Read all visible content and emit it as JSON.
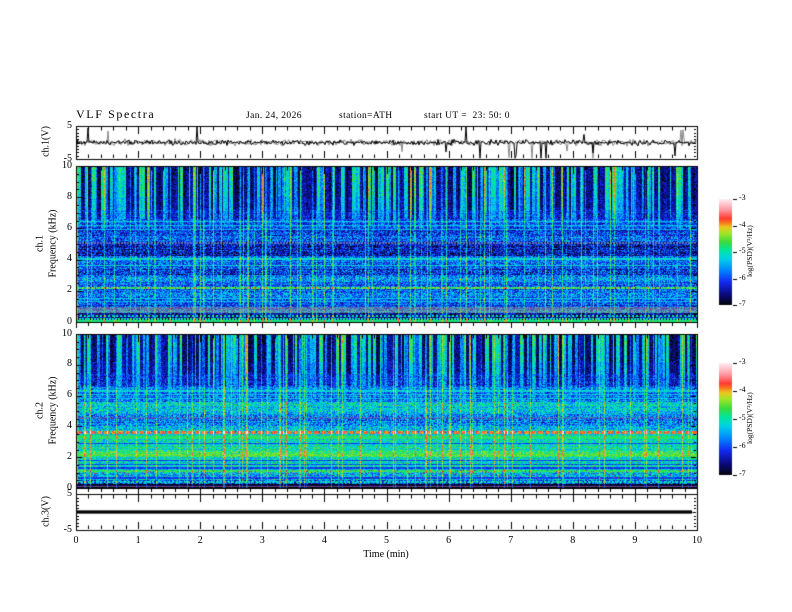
{
  "header": {
    "title": "VLF Spectra",
    "date": "Jan. 24, 2026",
    "station": "station=ATH",
    "start_ut": "start UT =  23: 50: 0"
  },
  "xaxis": {
    "label": "Time (min)",
    "ticks": [
      "0",
      "1",
      "2",
      "3",
      "4",
      "5",
      "6",
      "7",
      "8",
      "9",
      "10"
    ],
    "minor_per_major": 5,
    "range_min": [
      0,
      10
    ]
  },
  "panels": {
    "ch1_wave": {
      "label": "ch.1(V)",
      "yticks": [
        {
          "value": 5,
          "label": "5"
        },
        {
          "value": -5,
          "label": "-5"
        }
      ],
      "y_range": [
        -5,
        5
      ]
    },
    "spec1": {
      "channel": "ch.1",
      "axis": "Frequency (kHz)",
      "yticks": [
        0,
        2,
        4,
        6,
        8,
        10
      ],
      "y_range_khz": [
        0,
        10
      ]
    },
    "spec2": {
      "channel": "ch.2",
      "axis": "Frequency (kHz)",
      "yticks": [
        0,
        2,
        4,
        6,
        8,
        10
      ],
      "y_range_khz": [
        0,
        10
      ]
    },
    "ch3_wave": {
      "label": "ch.3(V)",
      "yticks": [
        {
          "value": 5,
          "label": "5"
        },
        {
          "value": -5,
          "label": "-5"
        }
      ],
      "y_range": [
        -5,
        5
      ]
    }
  },
  "colorbar": {
    "label": "log(PSD)(V²/Hz)",
    "ticks": [
      "-3",
      "-4",
      "-5",
      "-6",
      "-7"
    ],
    "value_range": [
      -7,
      -3
    ]
  },
  "chart_data": [
    {
      "type": "line",
      "name": "ch1-waveform",
      "ylabel": "ch.1(V)",
      "x_range_min": [
        0,
        10
      ],
      "y_range_v": [
        -5,
        5
      ],
      "description": "broadband noise around 0 V, ~±1 V, impulsive spikes mostly downward to -4 V",
      "noise_sigma": 0.5,
      "spike_rate": 0.012,
      "spike_amp": [
        1.5,
        4.5
      ],
      "spike_negative_fraction": 0.75,
      "trace_color": "#000000",
      "shadow_color": "#8a8a8a"
    },
    {
      "type": "heatmap",
      "name": "ch1-spectrogram",
      "x_range_min": [
        0,
        10
      ],
      "y_range_khz": [
        0,
        10
      ],
      "value_range_log_psd": [
        -7,
        -3
      ],
      "left_edge_value": 0.62,
      "vlines_count_prob": 0.12,
      "vline_boost": [
        0.12,
        0.28
      ],
      "bands": [
        {
          "lo": 9.0,
          "hi": 10.0,
          "v": 0.1,
          "n": 0.22,
          "streak": 1.0
        },
        {
          "lo": 8.0,
          "hi": 9.0,
          "v": 0.13,
          "n": 0.22,
          "streak": 0.92
        },
        {
          "lo": 7.2,
          "hi": 8.0,
          "v": 0.18,
          "n": 0.2,
          "streak": 0.75
        },
        {
          "lo": 6.6,
          "hi": 7.2,
          "v": 0.24,
          "n": 0.2,
          "streak": 0.5
        },
        {
          "lo": 6.0,
          "hi": 6.6,
          "v": 0.28,
          "n": 0.18,
          "streak": 0.25
        },
        {
          "lo": 5.15,
          "hi": 6.0,
          "v": 0.26,
          "n": 0.16
        },
        {
          "lo": 4.2,
          "hi": 5.15,
          "v": 0.17,
          "n": 0.17
        },
        {
          "lo": 3.4,
          "hi": 4.2,
          "v": 0.3,
          "n": 0.16
        },
        {
          "lo": 3.0,
          "hi": 3.4,
          "v": 0.22,
          "n": 0.18
        },
        {
          "lo": 2.55,
          "hi": 3.0,
          "v": 0.33,
          "n": 0.16
        },
        {
          "lo": 2.3,
          "hi": 2.55,
          "v": 0.27,
          "n": 0.14
        },
        {
          "lo": 1.2,
          "hi": 2.3,
          "v": 0.3,
          "n": 0.16
        },
        {
          "lo": 0.95,
          "hi": 1.2,
          "v": 0.27,
          "n": 0.15
        },
        {
          "lo": 0.75,
          "hi": 0.95,
          "v": 0.3,
          "n": 0.2,
          "tint": "#aa7788",
          "tm": 0.45,
          "spk": "#993399",
          "sp": 0.06
        },
        {
          "lo": 0.55,
          "hi": 0.75,
          "v": 0.33,
          "n": 0.2,
          "tint": "#a0a080",
          "tm": 0.45
        },
        {
          "lo": 0.28,
          "hi": 0.55,
          "v": 0.12,
          "n": 0.16
        },
        {
          "lo": 0.14,
          "hi": 0.28,
          "v": 0.1,
          "n": 0.2
        },
        {
          "lo": 0.0,
          "hi": 0.14,
          "v": 0.02,
          "n": 0.03
        }
      ],
      "lines": [
        {
          "f": 9.97,
          "w": 0.08,
          "v": 0.45
        },
        {
          "f": 6.45,
          "w": 0.06,
          "v": 0.42
        },
        {
          "f": 6.18,
          "w": 0.05,
          "v": 0.4
        },
        {
          "f": 5.95,
          "w": 0.05,
          "v": 0.38
        },
        {
          "f": 5.08,
          "w": 0.1,
          "v": 0.32,
          "dot": [
            3,
            1.6
          ],
          "tint": "#996688",
          "tm": 0.55
        },
        {
          "f": 4.03,
          "w": 0.07,
          "v": 0.45
        },
        {
          "f": 3.62,
          "w": 0.07,
          "v": 0.44
        },
        {
          "f": 2.2,
          "w": 0.11,
          "v": 0.62,
          "dot": [
            5,
            3.5
          ]
        },
        {
          "f": 1.52,
          "w": 0.05,
          "v": 0.42
        },
        {
          "f": 1.33,
          "w": 0.05,
          "v": 0.4
        },
        {
          "f": 0.4,
          "w": 0.07,
          "v": 0.5,
          "dot": [
            4,
            2
          ]
        },
        {
          "f": 0.2,
          "w": 0.06,
          "v": 0.5,
          "dot": [
            3,
            1.5
          ]
        },
        {
          "f": 0.06,
          "w": 0.05,
          "v": 0.55,
          "dot": [
            2,
            1.4
          ]
        }
      ]
    },
    {
      "type": "heatmap",
      "name": "ch2-spectrogram",
      "x_range_min": [
        0,
        10
      ],
      "y_range_khz": [
        0,
        10
      ],
      "value_range_log_psd": [
        -7,
        -3
      ],
      "left_edge_value": 0.62,
      "vlines_count_prob": 0.12,
      "vline_boost": [
        0.12,
        0.28
      ],
      "bands": [
        {
          "lo": 9.2,
          "hi": 10.0,
          "v": 0.12,
          "n": 0.22,
          "streak": 1.0
        },
        {
          "lo": 8.2,
          "hi": 9.2,
          "v": 0.14,
          "n": 0.22,
          "streak": 0.9
        },
        {
          "lo": 7.4,
          "hi": 8.2,
          "v": 0.2,
          "n": 0.2,
          "streak": 0.7
        },
        {
          "lo": 6.6,
          "hi": 7.4,
          "v": 0.26,
          "n": 0.2,
          "streak": 0.45
        },
        {
          "lo": 5.6,
          "hi": 6.6,
          "v": 0.33,
          "n": 0.18,
          "streak": 0.2
        },
        {
          "lo": 4.8,
          "hi": 5.6,
          "v": 0.44,
          "n": 0.15
        },
        {
          "lo": 4.0,
          "hi": 4.8,
          "v": 0.32,
          "n": 0.17
        },
        {
          "lo": 3.55,
          "hi": 4.0,
          "v": 0.44,
          "n": 0.15
        },
        {
          "lo": 2.4,
          "hi": 3.55,
          "v": 0.48,
          "n": 0.14
        },
        {
          "lo": 2.0,
          "hi": 2.4,
          "v": 0.55,
          "n": 0.12
        },
        {
          "lo": 1.15,
          "hi": 2.0,
          "v": 0.46,
          "n": 0.14
        },
        {
          "lo": 0.5,
          "hi": 1.15,
          "v": 0.42,
          "n": 0.17,
          "spk": "#883399",
          "sp": 0.05
        },
        {
          "lo": 0.25,
          "hi": 0.5,
          "v": 0.3,
          "n": 0.2
        },
        {
          "lo": 0.0,
          "hi": 0.25,
          "v": 0.03,
          "n": 0.04
        }
      ],
      "lines": [
        {
          "f": 9.97,
          "w": 0.08,
          "v": 0.48
        },
        {
          "f": 6.3,
          "w": 0.06,
          "v": 0.45
        },
        {
          "f": 6.05,
          "w": 0.05,
          "v": 0.43
        },
        {
          "f": 5.8,
          "w": 0.05,
          "v": 0.42
        },
        {
          "f": 4.55,
          "w": 0.08,
          "v": 0.28,
          "dot": [
            3,
            1.6
          ],
          "tint": "#996677",
          "tm": 0.5
        },
        {
          "f": 3.6,
          "w": 0.13,
          "v": 0.8,
          "dot": [
            7,
            5
          ]
        },
        {
          "f": 3.25,
          "w": 0.16,
          "v": 0.56
        },
        {
          "f": 2.9,
          "w": 0.05,
          "v": 0.26
        },
        {
          "f": 2.15,
          "w": 0.12,
          "v": 0.62
        },
        {
          "f": 1.8,
          "w": 0.05,
          "v": 0.24
        },
        {
          "f": 1.55,
          "w": 0.05,
          "v": 0.25
        },
        {
          "f": 1.3,
          "w": 0.05,
          "v": 0.24
        },
        {
          "f": 1.12,
          "w": 0.08,
          "v": 0.58
        },
        {
          "f": 0.65,
          "w": 0.05,
          "v": 0.24
        },
        {
          "f": 0.4,
          "w": 0.06,
          "v": 0.5,
          "dot": [
            4,
            2
          ]
        },
        {
          "f": 0.08,
          "w": 0.06,
          "v": 0.32,
          "tint": "#aa2222",
          "tm": 0.6
        }
      ]
    },
    {
      "type": "line",
      "name": "ch3-waveform",
      "ylabel": "ch.3(V)",
      "x_range_min": [
        0,
        10
      ],
      "y_range_v": [
        -5,
        5
      ],
      "description": "constant 0 V flat thick trace",
      "baseline_v": 0,
      "noise_sigma": 0,
      "trace_color": "#000000"
    }
  ],
  "colormap": {
    "stops": [
      [
        0.0,
        "#050505"
      ],
      [
        0.1,
        "#0a0a78"
      ],
      [
        0.22,
        "#1428f0"
      ],
      [
        0.34,
        "#008cff"
      ],
      [
        0.44,
        "#00d2e6"
      ],
      [
        0.52,
        "#00e6a0"
      ],
      [
        0.6,
        "#3cdc3c"
      ],
      [
        0.68,
        "#a0e628"
      ],
      [
        0.74,
        "#ebc81e"
      ],
      [
        0.78,
        "#fa781e"
      ],
      [
        0.82,
        "#ff3c32"
      ],
      [
        0.9,
        "#ff96a0"
      ],
      [
        1.0,
        "#ffebf0"
      ]
    ]
  }
}
